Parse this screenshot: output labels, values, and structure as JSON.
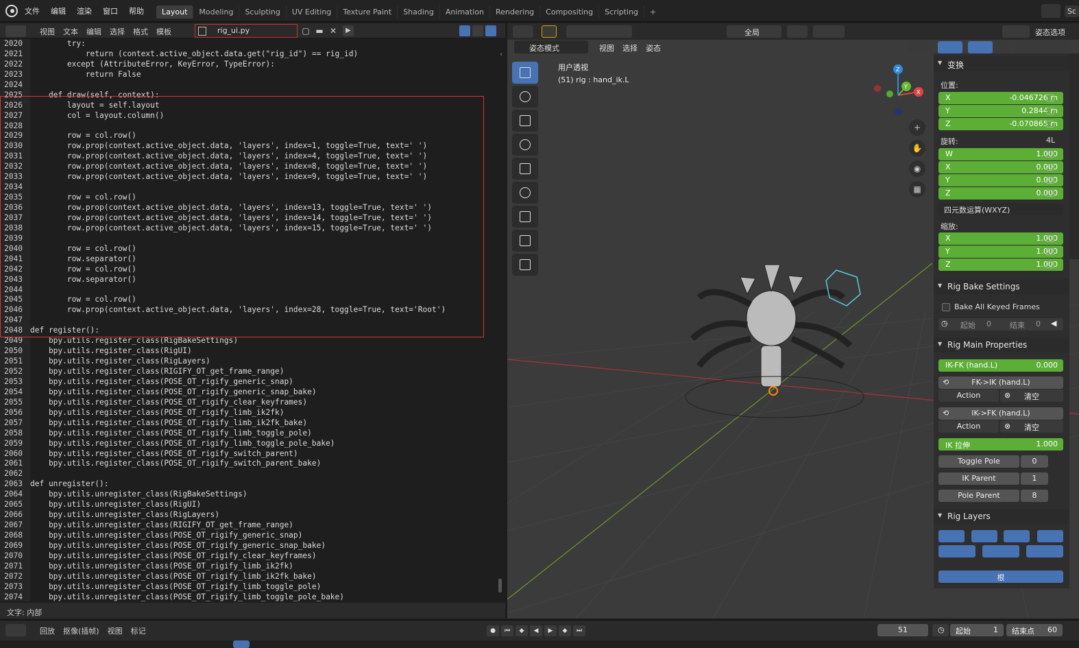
{
  "menubar": [
    "文件",
    "编辑",
    "渲染",
    "窗口",
    "帮助"
  ],
  "workspaces": [
    "Layout",
    "Modeling",
    "Sculpting",
    "UV Editing",
    "Texture Paint",
    "Shading",
    "Animation",
    "Rendering",
    "Compositing",
    "Scripting"
  ],
  "workspace_plus": "+",
  "topright_label": "Sc",
  "editor": {
    "menu": [
      "视图",
      "文本",
      "编辑",
      "选择",
      "格式",
      "模板"
    ],
    "filename": "rig_ui.py",
    "footer": "文字: 内部",
    "lines": [
      [
        "2020",
        "        try:"
      ],
      [
        "2021",
        "            return (context.active_object.data.get(\"rig_id\") == rig_id)"
      ],
      [
        "2022",
        "        except (AttributeError, KeyError, TypeError):"
      ],
      [
        "2023",
        "            return False"
      ],
      [
        "2024",
        ""
      ],
      [
        "2025",
        "    def draw(self, context):"
      ],
      [
        "2026",
        "        layout = self.layout"
      ],
      [
        "2027",
        "        col = layout.column()"
      ],
      [
        "2028",
        ""
      ],
      [
        "2029",
        "        row = col.row()"
      ],
      [
        "2030",
        "        row.prop(context.active_object.data, 'layers', index=1, toggle=True, text=' ')"
      ],
      [
        "2031",
        "        row.prop(context.active_object.data, 'layers', index=4, toggle=True, text=' ')"
      ],
      [
        "2032",
        "        row.prop(context.active_object.data, 'layers', index=8, toggle=True, text=' ')"
      ],
      [
        "2033",
        "        row.prop(context.active_object.data, 'layers', index=9, toggle=True, text=' ')"
      ],
      [
        "2034",
        ""
      ],
      [
        "2035",
        "        row = col.row()"
      ],
      [
        "2036",
        "        row.prop(context.active_object.data, 'layers', index=13, toggle=True, text=' ')"
      ],
      [
        "2037",
        "        row.prop(context.active_object.data, 'layers', index=14, toggle=True, text=' ')"
      ],
      [
        "2038",
        "        row.prop(context.active_object.data, 'layers', index=15, toggle=True, text=' ')"
      ],
      [
        "2039",
        ""
      ],
      [
        "2040",
        "        row = col.row()"
      ],
      [
        "2041",
        "        row.separator()"
      ],
      [
        "2042",
        "        row = col.row()"
      ],
      [
        "2043",
        "        row.separator()"
      ],
      [
        "2044",
        ""
      ],
      [
        "2045",
        "        row = col.row()"
      ],
      [
        "2046",
        "        row.prop(context.active_object.data, 'layers', index=28, toggle=True, text='Root')"
      ],
      [
        "2047",
        ""
      ],
      [
        "2048",
        "def register():"
      ],
      [
        "2049",
        "    bpy.utils.register_class(RigBakeSettings)"
      ],
      [
        "2050",
        "    bpy.utils.register_class(RigUI)"
      ],
      [
        "2051",
        "    bpy.utils.register_class(RigLayers)"
      ],
      [
        "2052",
        "    bpy.utils.register_class(RIGIFY_OT_get_frame_range)"
      ],
      [
        "2053",
        "    bpy.utils.register_class(POSE_OT_rigify_generic_snap)"
      ],
      [
        "2054",
        "    bpy.utils.register_class(POSE_OT_rigify_generic_snap_bake)"
      ],
      [
        "2055",
        "    bpy.utils.register_class(POSE_OT_rigify_clear_keyframes)"
      ],
      [
        "2056",
        "    bpy.utils.register_class(POSE_OT_rigify_limb_ik2fk)"
      ],
      [
        "2057",
        "    bpy.utils.register_class(POSE_OT_rigify_limb_ik2fk_bake)"
      ],
      [
        "2058",
        "    bpy.utils.register_class(POSE_OT_rigify_limb_toggle_pole)"
      ],
      [
        "2059",
        "    bpy.utils.register_class(POSE_OT_rigify_limb_toggle_pole_bake)"
      ],
      [
        "2060",
        "    bpy.utils.register_class(POSE_OT_rigify_switch_parent)"
      ],
      [
        "2061",
        "    bpy.utils.register_class(POSE_OT_rigify_switch_parent_bake)"
      ],
      [
        "2062",
        ""
      ],
      [
        "2063",
        "def unregister():"
      ],
      [
        "2064",
        "    bpy.utils.unregister_class(RigBakeSettings)"
      ],
      [
        "2065",
        "    bpy.utils.unregister_class(RigUI)"
      ],
      [
        "2066",
        "    bpy.utils.unregister_class(RigLayers)"
      ],
      [
        "2067",
        "    bpy.utils.unregister_class(RIGIFY_OT_get_frame_range)"
      ],
      [
        "2068",
        "    bpy.utils.unregister_class(POSE_OT_rigify_generic_snap)"
      ],
      [
        "2069",
        "    bpy.utils.unregister_class(POSE_OT_rigify_generic_snap_bake)"
      ],
      [
        "2070",
        "    bpy.utils.unregister_class(POSE_OT_rigify_clear_keyframes)"
      ],
      [
        "2071",
        "    bpy.utils.unregister_class(POSE_OT_rigify_limb_ik2fk)"
      ],
      [
        "2072",
        "    bpy.utils.unregister_class(POSE_OT_rigify_limb_ik2fk_bake)"
      ],
      [
        "2073",
        "    bpy.utils.unregister_class(POSE_OT_rigify_limb_toggle_pole)"
      ],
      [
        "2074",
        "    bpy.utils.unregister_class(POSE_OT_rigify_limb_toggle_pole_bake)"
      ]
    ]
  },
  "viewport": {
    "global_label": "全局",
    "pose_options": "姿态选项",
    "mode": "姿态模式",
    "menu": [
      "视图",
      "选择",
      "姿态"
    ],
    "title": "用户透视",
    "subtitle": "(51) rig : hand_ik.L",
    "gizmo_axes": {
      "x": "X",
      "y": "Y",
      "z": "Z"
    }
  },
  "npanel": {
    "transform": "变换",
    "location_label": "位置:",
    "location": [
      {
        "k": "X",
        "v": "-0.046726 m"
      },
      {
        "k": "Y",
        "v": "0.2844 m"
      },
      {
        "k": "Z",
        "v": "-0.070865 m"
      }
    ],
    "rotation_label": "旋转:",
    "rotation_badge": "4L",
    "rotation": [
      {
        "k": "W",
        "v": "1.000"
      },
      {
        "k": "X",
        "v": "0.000"
      },
      {
        "k": "Y",
        "v": "0.000"
      },
      {
        "k": "Z",
        "v": "0.000"
      }
    ],
    "rotation_mode": "四元数运算(WXYZ)",
    "scale_label": "缩放:",
    "scale": [
      {
        "k": "X",
        "v": "1.000"
      },
      {
        "k": "Y",
        "v": "1.000"
      },
      {
        "k": "Z",
        "v": "1.000"
      }
    ],
    "bake_title": "Rig Bake Settings",
    "bake_all": "Bake All Keyed Frames",
    "start_label": "起始",
    "start_val": "0",
    "end_label": "结束",
    "end_val": "0",
    "main_title": "Rig Main Properties",
    "ikfk_label": "IK-FK (hand.L)",
    "ikfk_val": "0.000",
    "fk_ik": "FK->IK (hand.L)",
    "ik_fk": "IK->FK (hand.L)",
    "action": "Action",
    "clear": "清空",
    "ik_stretch": "IK 拉伸",
    "ik_stretch_val": "1.000",
    "toggle_pole": "Toggle Pole",
    "toggle_pole_val": "0",
    "ik_parent": "IK Parent",
    "ik_parent_val": "1",
    "pole_parent": "Pole Parent",
    "pole_parent_val": "8",
    "layers_title": "Rig Layers",
    "root_btn": "根"
  },
  "timeline": {
    "menu": [
      "回放",
      "抠像(插帧)",
      "视图",
      "标记"
    ],
    "current_frame": "51",
    "start_label": "起始",
    "start_val": "1",
    "end_label": "结束点",
    "end_val": "60"
  },
  "colors": {
    "accent": "#4772b3",
    "field_green": "#5cae36",
    "highlight_red": "#d33333"
  }
}
